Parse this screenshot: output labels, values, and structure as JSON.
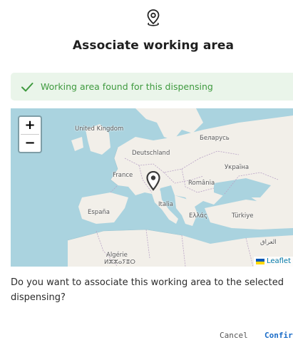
{
  "dialog": {
    "icon": "map-pin-icon",
    "title": "Associate working area",
    "alert": {
      "icon": "check-icon",
      "text": "Working area found for this dispensing",
      "color": "#3f9a3f",
      "background": "#eaf5ea"
    },
    "map": {
      "zoom_in_label": "+",
      "zoom_out_label": "−",
      "marker_icon": "map-marker-icon",
      "labels": {
        "united_kingdom": "United Kingdom",
        "belarus": "Беларусь",
        "deutschland": "Deutschland",
        "ukraine": "Україна",
        "france": "France",
        "romania": "România",
        "italia": "Italia",
        "espana": "España",
        "greece": "Ελλάς",
        "turkiye": "Türkiye",
        "iraq": "العراق",
        "algerie": "Algérie",
        "algeria_tifinagh": "ⵍⵣⵣⴰⵢⴻⵔ"
      },
      "attribution": {
        "flag_icon": "ukraine-flag-icon",
        "text": "Leaflet"
      }
    },
    "question": "Do you want to associate this working area to the selected dispensing?",
    "buttons": {
      "cancel": "Cancel",
      "confirm": "Confirm"
    }
  }
}
